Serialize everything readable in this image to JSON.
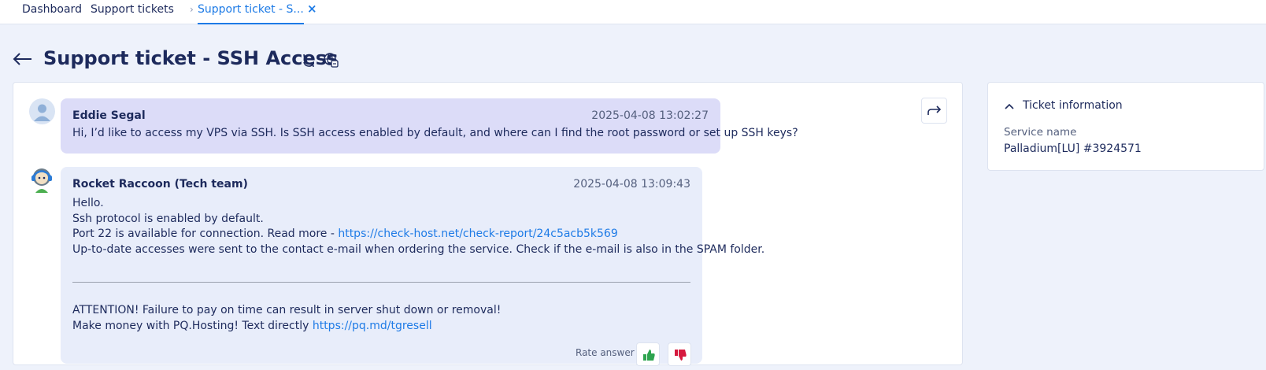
{
  "tabs": {
    "dashboard": "Dashboard",
    "support_tickets": "Support tickets",
    "current": "Support ticket - S...",
    "close": "×"
  },
  "header": {
    "title": "Support ticket - SSH Access",
    "back_icon": "arrow-left-icon",
    "refresh_icon": "refresh-icon",
    "translate_icon": "globe-translate-icon"
  },
  "conversation": {
    "forward_icon": "forward-arrow-icon",
    "messages": [
      {
        "author": "Eddie Segal",
        "time": "2025-04-08 13:02:27",
        "text": "Hi, I’d like to access my VPS via SSH. Is SSH access enabled by default, and where can I find the root password or set up SSH keys?"
      },
      {
        "author": "Rocket Raccoon (Tech team)",
        "time": "2025-04-08 13:09:43",
        "line1": "Hello.",
        "line2": "Ssh protocol is enabled by default.",
        "line3_prefix": "Port 22 is available for connection. Read more - ",
        "line3_link": "https://check-host.net/check-report/24c5acb5k569",
        "line4": "Up-to-date accesses were sent to the contact e-mail when ordering the service. Check if the e-mail is also in the SPAM folder.",
        "notice1": "ATTENTION! Failure to pay on time can result in server shut down or removal!",
        "notice2_prefix": "Make money with PQ.Hosting! Text directly ",
        "notice2_link": "https://pq.md/tgresell",
        "rate_label": "Rate answer"
      }
    ]
  },
  "ticket_info": {
    "title": "Ticket information",
    "service_label": "Service name",
    "service_value": "Palladium[LU] #3924571"
  },
  "colors": {
    "accent": "#1e7be6",
    "user_bubble": "#dcdcf8",
    "agent_bubble": "#e8edfa",
    "background": "#eef2fb"
  }
}
